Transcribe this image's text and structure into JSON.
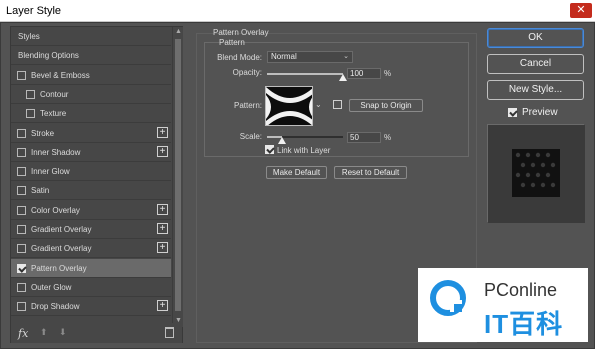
{
  "window": {
    "title": "Layer Style",
    "close_label": "✕"
  },
  "styles_list": [
    {
      "label": "Styles",
      "checkbox": false,
      "checked": false,
      "plus": false,
      "indent": 0,
      "selected": false
    },
    {
      "label": "Blending Options",
      "checkbox": false,
      "checked": false,
      "plus": false,
      "indent": 0,
      "selected": false
    },
    {
      "label": "Bevel & Emboss",
      "checkbox": true,
      "checked": false,
      "plus": false,
      "indent": 0,
      "selected": false
    },
    {
      "label": "Contour",
      "checkbox": true,
      "checked": false,
      "plus": false,
      "indent": 1,
      "selected": false
    },
    {
      "label": "Texture",
      "checkbox": true,
      "checked": false,
      "plus": false,
      "indent": 1,
      "selected": false
    },
    {
      "label": "Stroke",
      "checkbox": true,
      "checked": false,
      "plus": true,
      "indent": 0,
      "selected": false
    },
    {
      "label": "Inner Shadow",
      "checkbox": true,
      "checked": false,
      "plus": true,
      "indent": 0,
      "selected": false
    },
    {
      "label": "Inner Glow",
      "checkbox": true,
      "checked": false,
      "plus": false,
      "indent": 0,
      "selected": false
    },
    {
      "label": "Satin",
      "checkbox": true,
      "checked": false,
      "plus": false,
      "indent": 0,
      "selected": false
    },
    {
      "label": "Color Overlay",
      "checkbox": true,
      "checked": false,
      "plus": true,
      "indent": 0,
      "selected": false
    },
    {
      "label": "Gradient Overlay",
      "checkbox": true,
      "checked": false,
      "plus": true,
      "indent": 0,
      "selected": false
    },
    {
      "label": "Gradient Overlay",
      "checkbox": true,
      "checked": false,
      "plus": true,
      "indent": 0,
      "selected": false
    },
    {
      "label": "Pattern Overlay",
      "checkbox": true,
      "checked": true,
      "plus": false,
      "indent": 0,
      "selected": true
    },
    {
      "label": "Outer Glow",
      "checkbox": true,
      "checked": false,
      "plus": false,
      "indent": 0,
      "selected": false
    },
    {
      "label": "Drop Shadow",
      "checkbox": true,
      "checked": false,
      "plus": true,
      "indent": 0,
      "selected": false
    }
  ],
  "bottom_bar": {
    "fx_label": "fx",
    "fx_icon": "fx-icon",
    "up_icon": "move-up-icon",
    "down_icon": "move-down-icon",
    "trash_icon": "trash-icon"
  },
  "pattern_overlay": {
    "section_title": "Pattern Overlay",
    "group_title": "Pattern",
    "blend_mode_label": "Blend Mode:",
    "blend_mode_value": "Normal",
    "opacity_label": "Opacity:",
    "opacity_value": "100",
    "opacity_unit": "%",
    "opacity_fraction": 1.0,
    "pattern_label": "Pattern:",
    "snap_button": "Snap to Origin",
    "scale_label": "Scale:",
    "scale_value": "50",
    "scale_unit": "%",
    "scale_fraction": 0.2,
    "link_label": "Link with Layer",
    "link_checked": true,
    "make_default": "Make Default",
    "reset_default": "Reset to Default"
  },
  "right": {
    "ok": "OK",
    "cancel": "Cancel",
    "new_style": "New Style...",
    "preview_label": "Preview",
    "preview_checked": true
  },
  "watermark": {
    "brand": "PConline",
    "cn": "IT百科",
    "accent": "#1e8fe0"
  },
  "colors": {
    "dialog_bg": "#535353",
    "panel_bg": "#474747",
    "selected_row": "#6a6a6a",
    "ok_border": "#4a8ad8"
  }
}
